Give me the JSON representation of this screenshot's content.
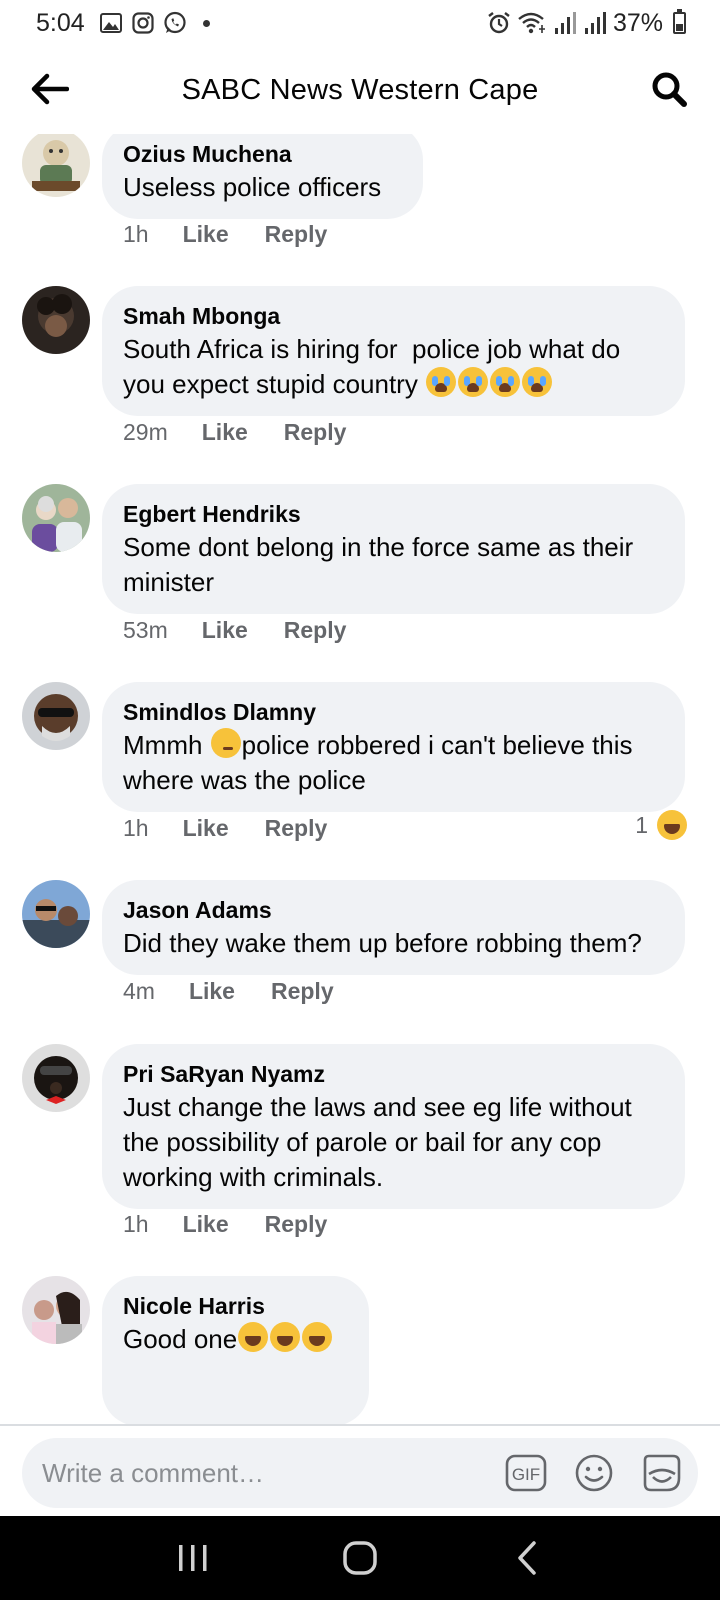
{
  "status_bar": {
    "time": "5:04",
    "battery": "37%"
  },
  "header": {
    "title": "SABC News Western Cape"
  },
  "comments": [
    {
      "author": "Ozius Muchena",
      "text": "Useless police officers",
      "age": "1h",
      "like_label": "Like",
      "reply_label": "Reply"
    },
    {
      "author": "Smah Mbonga",
      "text_line1": "South Africa is hiring for  police job what do",
      "text_line2": "you expect stupid country",
      "emojis": "loudly-crying-face x4",
      "age": "29m",
      "like_label": "Like",
      "reply_label": "Reply"
    },
    {
      "author": "Egbert Hendriks",
      "text_line1": "Some dont belong in the force same as their",
      "text_line2": "minister",
      "age": "53m",
      "like_label": "Like",
      "reply_label": "Reply"
    },
    {
      "author": "Smindlos Dlamny",
      "text_line1_pre": "Mmmh ",
      "text_line1_post": "police robbered i can't believe this",
      "text_line2": "where was the police",
      "age": "1h",
      "like_label": "Like",
      "reply_label": "Reply",
      "reaction_count": "1",
      "reaction_icon": "laughing-face"
    },
    {
      "author": "Jason Adams",
      "text": "Did they wake them up before robbing them?",
      "age": "4m",
      "like_label": "Like",
      "reply_label": "Reply"
    },
    {
      "author": "Pri SaRyan Nyamz",
      "text_line1": "Just change the laws and see eg life without",
      "text_line2": "the possibility of parole or bail for any cop",
      "text_line3": "working with criminals.",
      "age": "1h",
      "like_label": "Like",
      "reply_label": "Reply"
    },
    {
      "author": "Nicole Harris",
      "text": "Good one",
      "emojis": "rolling-on-floor-laughing x3"
    }
  ],
  "composer": {
    "placeholder": "Write a comment…",
    "gif_label": "GIF"
  },
  "colors": {
    "bubble": "#f0f2f5",
    "secondary_text": "#65676b",
    "emoji_yellow": "#f7c23a"
  }
}
